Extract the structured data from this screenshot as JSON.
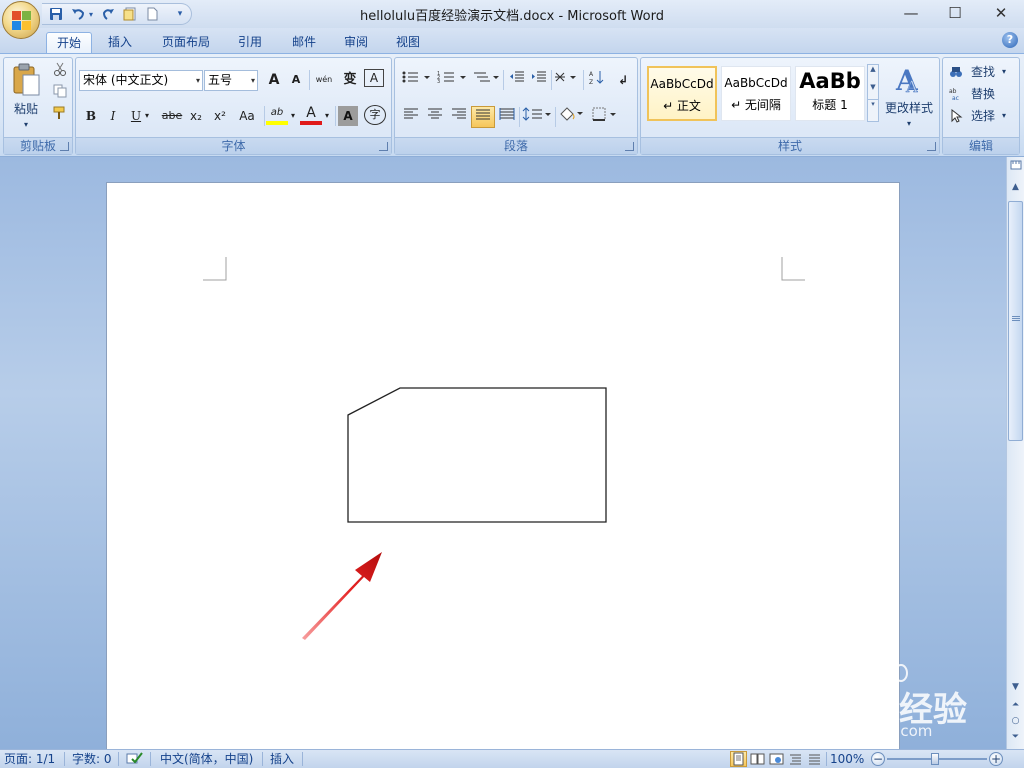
{
  "window": {
    "title": "hellolulu百度经验演示文档.docx - Microsoft Word",
    "minimize_label": "—",
    "maximize_label": "☐",
    "close_label": "✕"
  },
  "qat": {
    "save_icon": "save-icon",
    "undo_icon": "undo-icon",
    "redo_icon": "redo-icon",
    "customize_label": "▾"
  },
  "tabs": [
    {
      "label": "开始",
      "active": true
    },
    {
      "label": "插入"
    },
    {
      "label": "页面布局"
    },
    {
      "label": "引用"
    },
    {
      "label": "邮件"
    },
    {
      "label": "审阅"
    },
    {
      "label": "视图"
    }
  ],
  "help_label": "?",
  "ribbon": {
    "clipboard": {
      "label": "剪贴板",
      "paste_label": "粘贴"
    },
    "font": {
      "label": "字体",
      "font_name": "宋体 (中文正文)",
      "font_size": "五号",
      "grow_label": "A",
      "shrink_label": "A",
      "bold_label": "B",
      "italic_label": "I",
      "underline_label": "U",
      "strike_label": "abe",
      "sub_label": "x₂",
      "sup_label": "x²",
      "case_label": "Aa",
      "pinyin_label": "wén",
      "change_label": "变",
      "border_label": "A",
      "highlight_label": "ab",
      "color_label": "A",
      "shade_label": "A",
      "enclose_label": "字",
      "highlight_color": "#ffff00",
      "font_color": "#e01a1a"
    },
    "paragraph": {
      "label": "段落"
    },
    "styles": {
      "label": "样式",
      "items": [
        {
          "sample": "AaBbCcDd",
          "name": "↵ 正文",
          "active": true
        },
        {
          "sample": "AaBbCcDd",
          "name": "↵ 无间隔"
        },
        {
          "sample": "AaBb",
          "name": "标题 1"
        }
      ],
      "change_styles_label": "更改样式"
    },
    "editing": {
      "label": "编辑",
      "find_label": "查找",
      "replace_label": "替换",
      "select_label": "选择"
    }
  },
  "statusbar": {
    "page": "页面: 1/1",
    "words": "字数: 0",
    "language": "中文(简体，中国)",
    "mode": "插入",
    "zoom": "100%",
    "zoom_out_label": "−",
    "zoom_in_label": "+"
  },
  "watermark": {
    "text": "Baidu经验",
    "url": "jingyan.baidu.com"
  },
  "colors": {
    "arrow": "#e52222",
    "ribbon_accent": "#15428b"
  }
}
